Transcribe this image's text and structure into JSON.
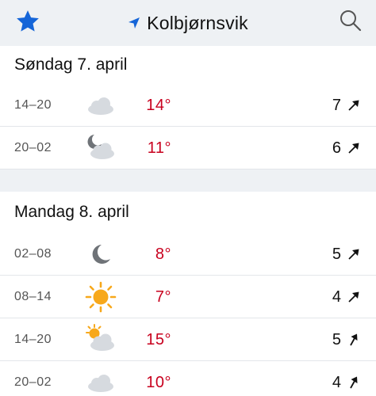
{
  "header": {
    "location": "Kolbjørnsvik",
    "favorite_icon": "star-icon",
    "search_icon": "search-icon",
    "location_icon": "location-arrow-icon",
    "accent_color": "#1565d8"
  },
  "days": [
    {
      "title": "Søndag 7. april",
      "rows": [
        {
          "time": "14–20",
          "symbol": "cloudy-icon",
          "temp": "14°",
          "wind": "7",
          "wind_icon": "wind-arrow-northeast-icon"
        },
        {
          "time": "20–02",
          "symbol": "partly-cloudy-night-icon",
          "temp": "11°",
          "wind": "6",
          "wind_icon": "wind-arrow-northeast-icon"
        }
      ]
    },
    {
      "title": "Mandag 8. april",
      "rows": [
        {
          "time": "02–08",
          "symbol": "clear-night-moon-icon",
          "temp": "8°",
          "wind": "5",
          "wind_icon": "wind-arrow-northeast-icon"
        },
        {
          "time": "08–14",
          "symbol": "clear-sun-icon",
          "temp": "7°",
          "wind": "4",
          "wind_icon": "wind-arrow-northeast-icon"
        },
        {
          "time": "14–20",
          "symbol": "partly-cloudy-day-icon",
          "temp": "15°",
          "wind": "5",
          "wind_icon": "wind-arrow-north-northeast-icon"
        },
        {
          "time": "20–02",
          "symbol": "cloudy-icon",
          "temp": "10°",
          "wind": "4",
          "wind_icon": "wind-arrow-north-northeast-icon"
        }
      ]
    }
  ],
  "colors": {
    "temperature": "#c8001e",
    "header_bg": "#eef1f4"
  }
}
